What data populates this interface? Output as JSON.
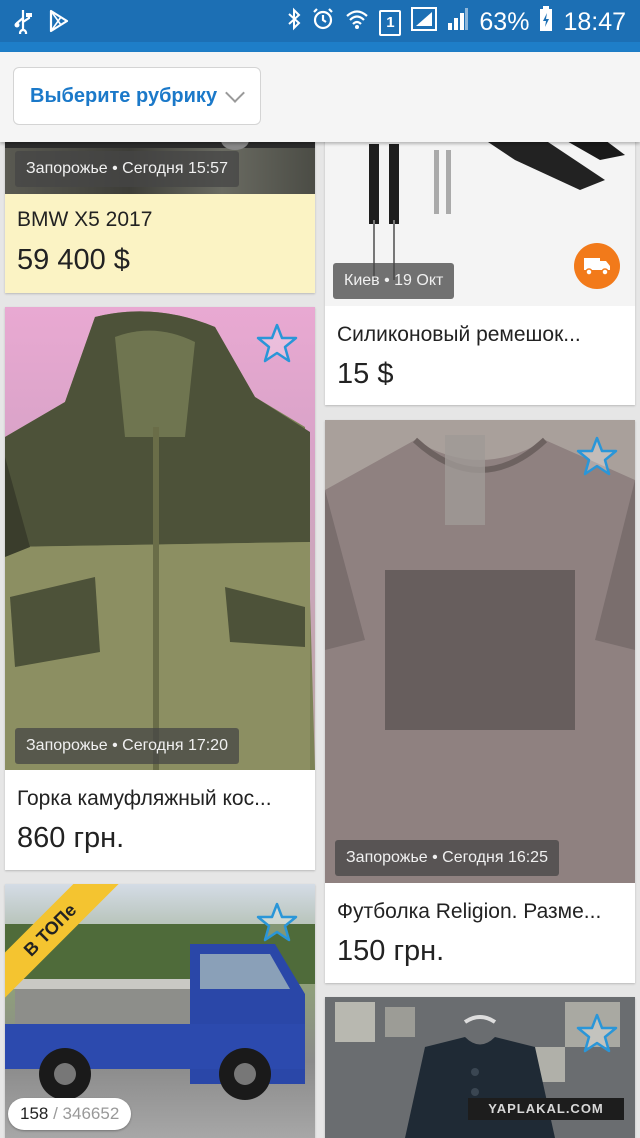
{
  "status_bar": {
    "battery": "63%",
    "time": "18:47",
    "sim": "1"
  },
  "header": {
    "category_button": "Выберите рубрику"
  },
  "listings": [
    {
      "location": "Запорожье • Сегодня 15:57",
      "title": "BMW X5 2017",
      "price": "59 400 $",
      "highlight": "#fbf3c4"
    },
    {
      "location": "Киев • 19 Окт",
      "title": "Силиконовый ремешок...",
      "price": "15 $",
      "delivery_icon": "delivery-truck-icon"
    },
    {
      "location": "Запорожье • Сегодня 17:20",
      "title": "Горка камуфляжный кос...",
      "price": "860 грн."
    },
    {
      "location": "Запорожье • Сегодня 16:25",
      "title": "Футболка Religion. Разме...",
      "price": "150 грн."
    },
    {
      "badge": "В ТОПе"
    },
    {}
  ],
  "counter": {
    "current": "158",
    "total": "/ 346652"
  },
  "watermark": "YAPLAKAL.COM",
  "colors": {
    "status_bar": "#1c6fb4",
    "link": "#1b79c9",
    "star": "#2a96d8",
    "badge": "#f4c430",
    "delivery": "#f27a1a"
  }
}
